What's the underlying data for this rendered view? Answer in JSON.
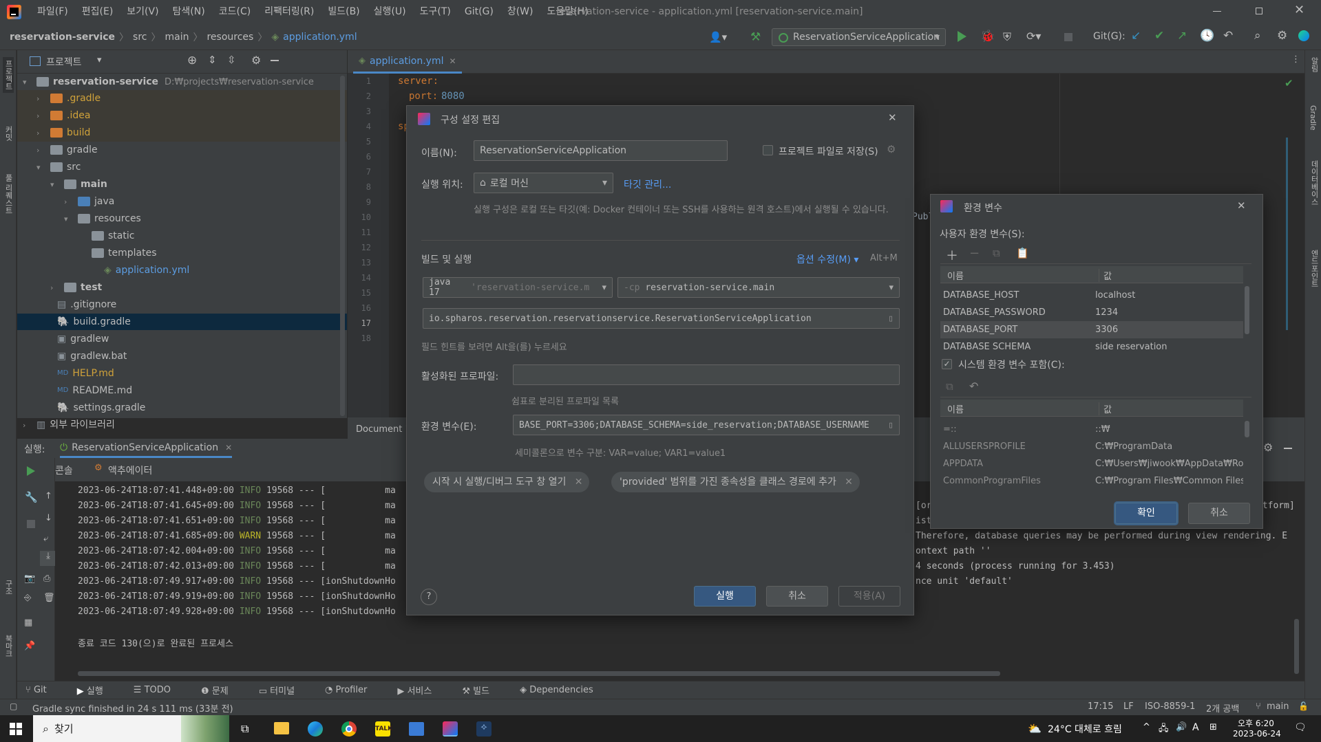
{
  "menu": [
    "파일(F)",
    "편집(E)",
    "보기(V)",
    "탐색(N)",
    "코드(C)",
    "리팩터링(R)",
    "빌드(B)",
    "실행(U)",
    "도구(T)",
    "Git(G)",
    "창(W)",
    "도움말(H)"
  ],
  "window_title": "reservation-service - application.yml [reservation-service.main]",
  "breadcrumb": [
    "reservation-service",
    "src",
    "main",
    "resources",
    "application.yml"
  ],
  "run_config": "ReservationServiceApplication",
  "git_label": "Git(G):",
  "left_stripe": [
    "프로젝트",
    "커밋",
    "풀 리퀘스트",
    "구조",
    "북마크"
  ],
  "right_stripe": [
    "알림",
    "Gradle",
    "데이터베이스",
    "엔드포인트"
  ],
  "project": {
    "title": "프로젝트",
    "root": "reservation-service",
    "root_path": "D:₩projects₩reservation-service",
    "items": [
      ".gradle",
      ".idea",
      "build",
      "gradle",
      "src",
      "main",
      "java",
      "resources",
      "static",
      "templates",
      "application.yml",
      "test",
      ".gitignore",
      "build.gradle",
      "gradlew",
      "gradlew.bat",
      "HELP.md",
      "README.md",
      "settings.gradle",
      "외부 라이브러리"
    ]
  },
  "editor": {
    "tab": "application.yml",
    "line_numbers": [
      "1",
      "2",
      "3",
      "4",
      "5",
      "6",
      "7",
      "8",
      "9",
      "10",
      "11",
      "12",
      "13",
      "14",
      "15",
      "16",
      "17",
      "18"
    ],
    "line1": "server:",
    "line2_key": "port:",
    "line2_val": "8080",
    "line4": "sp",
    "right_fragment": "Publ",
    "bottom_tab": "Document 1"
  },
  "run": {
    "label": "실행:",
    "tab": "ReservationServiceApplication",
    "console_tab": "콘솔",
    "actuator_tab": "액추에이터",
    "logs": [
      {
        "ts": "2023-06-24T18:07:41.448+09:00",
        "lvl": "INFO",
        "rest": " 19568 --- [",
        "tail": "           ma"
      },
      {
        "ts": "2023-06-24T18:07:41.645+09:00",
        "lvl": "INFO",
        "rest": " 19568 --- [",
        "tail": "           ma"
      },
      {
        "ts": "2023-06-24T18:07:41.651+09:00",
        "lvl": "INFO",
        "rest": " 19568 --- [",
        "tail": "           ma"
      },
      {
        "ts": "2023-06-24T18:07:41.685+09:00",
        "lvl": "WARN",
        "rest": " 19568 --- [",
        "tail": "           ma"
      },
      {
        "ts": "2023-06-24T18:07:42.004+09:00",
        "lvl": "INFO",
        "rest": " 19568 --- [",
        "tail": "           ma"
      },
      {
        "ts": "2023-06-24T18:07:42.013+09:00",
        "lvl": "INFO",
        "rest": " 19568 --- [",
        "tail": "           ma"
      },
      {
        "ts": "2023-06-24T18:07:49.917+09:00",
        "lvl": "INFO",
        "rest": " 19568 --- [ionShutdownHo",
        "tail": ""
      },
      {
        "ts": "2023-06-24T18:07:49.919+09:00",
        "lvl": "INFO",
        "rest": " 19568 --- [ionShutdownHo",
        "tail": ""
      },
      {
        "ts": "2023-06-24T18:07:49.928+09:00",
        "lvl": "INFO",
        "rest": " 19568 --- [ionShutdownHo",
        "tail": ""
      }
    ],
    "right_fragments": [
      "[or",
      "ist",
      "Therefore, database queries may be performed during view rendering. E",
      "ontext path ''",
      "4 seconds (process running for 3.453)",
      "nce unit 'default'"
    ],
    "right_far": "atform]",
    "exit": "종료 코드 130(으)로 완료된 프로세스"
  },
  "bottom_tools": [
    "Git",
    "실행",
    "TODO",
    "문제",
    "터미널",
    "Profiler",
    "서비스",
    "빌드",
    "Dependencies"
  ],
  "status": {
    "message": "Gradle sync finished in 24 s 111 ms (33분 전)",
    "position": "17:15",
    "line_sep": "LF",
    "encoding": "ISO-8859-1",
    "indent": "2개 공백",
    "branch": "main"
  },
  "config_dialog": {
    "title": "구성 설정 편집",
    "name_label": "이름(N):",
    "name_value": "ReservationServiceApplication",
    "store_label": "프로젝트 파일로 저장(S)",
    "run_on_label": "실행 위치:",
    "run_on_value": "로컬 머신",
    "manage_targets": "타깃 관리...",
    "run_on_hint": "실행 구성은 로컬 또는 타깃(예: Docker 컨테이너 또는 SSH를 사용하는 원격 호스트)에서 실행될 수 있습니다.",
    "build_run_label": "빌드 및 실행",
    "modify_options": "옵션 수정(M)",
    "modify_shortcut": "Alt+M",
    "jdk_value": "java 17",
    "jdk_hint": "'reservation-service.m",
    "cp_prefix": "-cp",
    "cp_value": "reservation-service.main",
    "main_class": "io.spharos.reservation.reservationservice.ReservationServiceApplication",
    "field_hint": "필드 힌트를 보려면 Alt을(를) 누르세요",
    "profiles_label": "활성화된 프로파일:",
    "profiles_hint": "쉼표로 분리된 프로파일 목록",
    "env_label": "환경 변수(E):",
    "env_value": "BASE_PORT=3306;DATABASE_SCHEMA=side_reservation;DATABASE_USERNAME",
    "env_hint": "세미콜론으로 변수 구분: VAR=value; VAR1=value1",
    "chip1": "시작 시 실행/디버그 도구 창 열기",
    "chip2": "'provided' 범위를 가진 종속성을 클래스 경로에 추가",
    "run_btn": "실행",
    "cancel_btn": "취소",
    "apply_btn": "적용(A)"
  },
  "env_dialog": {
    "title": "환경 변수",
    "user_label": "사용자 환경 변수(S):",
    "col_name": "이름",
    "col_value": "값",
    "user_vars": [
      {
        "name": "DATABASE_HOST",
        "value": "localhost"
      },
      {
        "name": "DATABASE_PASSWORD",
        "value": "1234"
      },
      {
        "name": "DATABASE_PORT",
        "value": "3306"
      },
      {
        "name": "DATABASE SCHEMA",
        "value": "side reservation"
      }
    ],
    "include_system": "시스템 환경 변수 포함(C):",
    "system_vars": [
      {
        "name": "=::",
        "value": "::₩"
      },
      {
        "name": "ALLUSERSPROFILE",
        "value": "C:₩ProgramData"
      },
      {
        "name": "APPDATA",
        "value": "C:₩Users₩jiwook₩AppData₩Ro..."
      },
      {
        "name": "CommonProgramFiles",
        "value": "C:₩Program Files₩Common Files"
      }
    ],
    "ok_btn": "확인",
    "cancel_btn": "취소"
  },
  "taskbar": {
    "search": "찾기",
    "weather": "24°C 대체로 흐림",
    "time": "오후 6:20",
    "date": "2023-06-24",
    "ime": "A"
  },
  "colors": {
    "accent": "#365880",
    "run_green": "#499c54",
    "key_orange": "#cc7832",
    "num_blue": "#6897bb",
    "warn": "#bbb529"
  }
}
